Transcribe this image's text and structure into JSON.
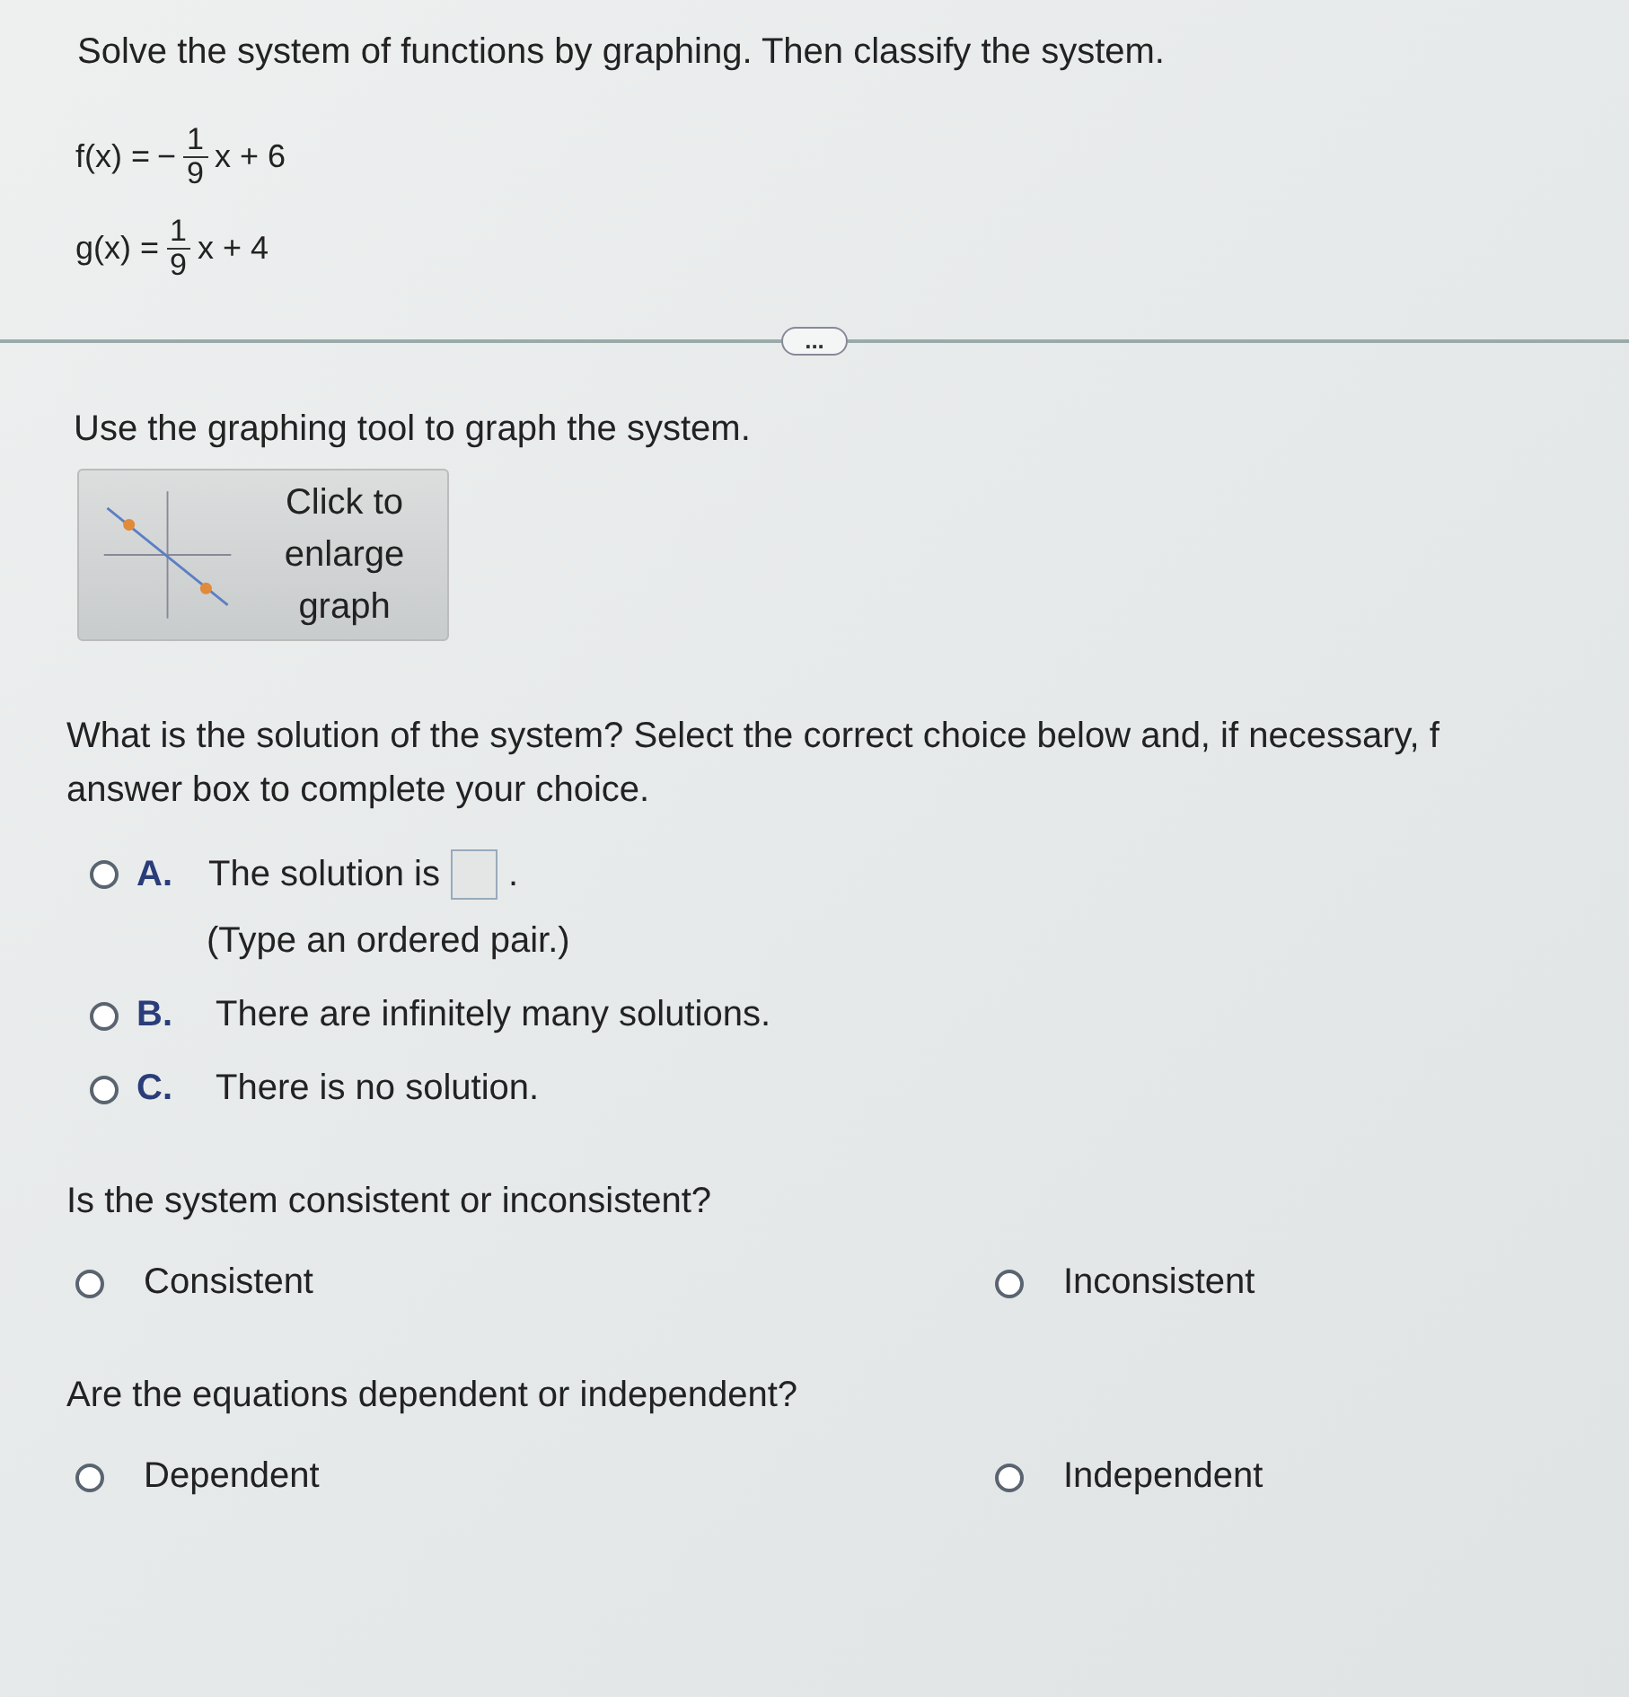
{
  "instruction": "Solve the system of functions by graphing. Then classify the system.",
  "functions": [
    {
      "name": "f(x) =",
      "sign": "−",
      "numerator": "1",
      "denominator": "9",
      "rest": "x + 6"
    },
    {
      "name": "g(x) =",
      "numerator": "1",
      "denominator": "9",
      "rest": "x + 4"
    }
  ],
  "expand_button": "...",
  "graph_instruction": "Use the graphing tool to graph the system.",
  "graph_button": "Click to enlarge graph",
  "question_lines": [
    "What is the solution of the system? Select the correct choice below and, if necessary, f",
    "answer box to complete your choice."
  ],
  "choices": [
    {
      "kind": "answer",
      "letter": "A.",
      "text": "The solution is",
      "after": ".",
      "hint": "(Type an ordered pair.)",
      "selected": false
    },
    {
      "kind": "plain",
      "letter": "B.",
      "text": "There are infinitely many solutions.",
      "selected": false
    },
    {
      "kind": "plain",
      "letter": "C.",
      "text": "There is no solution.",
      "selected": false
    }
  ],
  "questions": [
    {
      "prompt": "Is the system consistent or inconsistent?",
      "options": [
        {
          "label": "Consistent",
          "selected": false
        },
        {
          "label": "Inconsistent",
          "selected": false
        }
      ]
    },
    {
      "prompt": "Are the equations dependent or independent?",
      "options": [
        {
          "label": "Dependent",
          "selected": false
        },
        {
          "label": "Independent",
          "selected": false
        }
      ]
    }
  ]
}
